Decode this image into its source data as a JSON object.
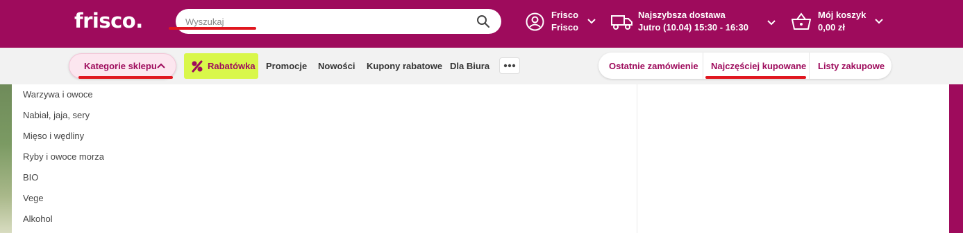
{
  "brand": {
    "logo": "frisco",
    "logo_dot": ".",
    "color": "#9e0b5c"
  },
  "search": {
    "placeholder": "Wyszukaj"
  },
  "account": {
    "line1": "Frisco",
    "line2": "Frisco"
  },
  "delivery": {
    "title": "Najszybsza dostawa",
    "slot": "Jutro (10.04) 15:30 - 16:30"
  },
  "cart": {
    "title": "Mój koszyk",
    "amount": "0,00 zł"
  },
  "nav": {
    "categories": "Kategorie sklepu",
    "rabatowka": "Rabatówka",
    "links": [
      "Promocje",
      "Nowości",
      "Kupony rabatowe",
      "Dla Biura"
    ]
  },
  "quick": {
    "last_order": "Ostatnie zamówienie",
    "most_bought": "Najczęściej kupowane",
    "lists": "Listy zakupowe"
  },
  "categories": [
    "Warzywa i owoce",
    "Nabiał, jaja, sery",
    "Mięso i wędliny",
    "Ryby i owoce morza",
    "BIO",
    "Vege",
    "Alkohol"
  ],
  "colors": {
    "accent": "#9e0b5c",
    "promo": "#d9f74a",
    "highlight": "#e0161f"
  }
}
